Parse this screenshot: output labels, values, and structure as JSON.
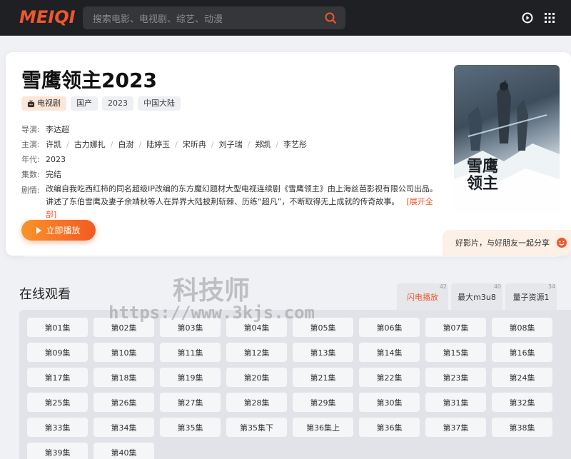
{
  "header": {
    "logo": "MEIQI",
    "search_placeholder": "搜索电影、电视剧、综艺、动漫"
  },
  "detail": {
    "title": "雪鹰领主2023",
    "type_tag": "电视剧",
    "tags": [
      "国产",
      "2023",
      "中国大陆"
    ],
    "director_label": "导演:",
    "director": "李达超",
    "cast_label": "主演:",
    "cast": [
      "许凯",
      "古力娜扎",
      "白澍",
      "陆婷玉",
      "宋昕冉",
      "刘子瑞",
      "郑凯",
      "李艺彤"
    ],
    "year_label": "年代:",
    "year": "2023",
    "episodes_label": "集数:",
    "episodes": "完结",
    "plot_label": "剧情:",
    "plot": "改编自我吃西红柿的同名超级IP改编的东方魔幻题材大型电视连续剧《雪鹰领主》由上海丝芭影视有限公司出品。讲述了东伯雪鹰及妻子余靖秋等人在异界大陆披荆斩棘、历练“超凡”，不断取得无上成就的传奇故事。",
    "more_label": "[展开全部]",
    "play_label": "立即播放",
    "poster_text": "雪鹰领主",
    "share_text": "好影片，与好朋友一起分享"
  },
  "online": {
    "title": "在线观看",
    "sources": [
      {
        "name": "闪电播放",
        "count": "42"
      },
      {
        "name": "最大m3u8",
        "count": "40"
      },
      {
        "name": "量子资源1",
        "count": "34"
      }
    ],
    "episodes": [
      "第01集",
      "第02集",
      "第03集",
      "第04集",
      "第05集",
      "第06集",
      "第07集",
      "第08集",
      "第09集",
      "第10集",
      "第11集",
      "第12集",
      "第13集",
      "第14集",
      "第15集",
      "第16集",
      "第17集",
      "第18集",
      "第19集",
      "第20集",
      "第21集",
      "第22集",
      "第23集",
      "第24集",
      "第25集",
      "第26集",
      "第27集",
      "第28集",
      "第29集",
      "第30集",
      "第31集",
      "第32集",
      "第33集",
      "第34集",
      "第35集",
      "第35集下",
      "第36集上",
      "第36集",
      "第37集",
      "第38集",
      "第39集",
      "第40集"
    ]
  },
  "watermark": {
    "text": "科技师",
    "url": "https://www.3kjs.com"
  },
  "colors": {
    "accent": "#f0572d",
    "header_bg": "#1f2023"
  }
}
